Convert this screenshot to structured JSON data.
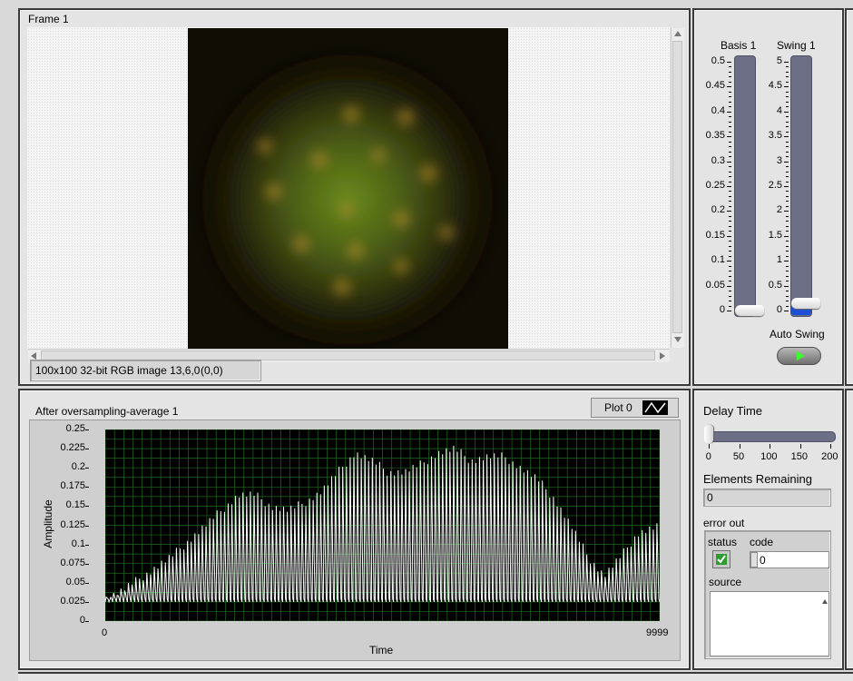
{
  "frame_panel": {
    "title": "Frame 1",
    "image_info": "100x100 32-bit RGB image 13,6,0",
    "cursor_coords": "(0,0)"
  },
  "sliders": {
    "basis": {
      "label": "Basis 1",
      "ticks": [
        "0.5",
        "0.45",
        "0.4",
        "0.35",
        "0.3",
        "0.25",
        "0.2",
        "0.15",
        "0.1",
        "0.05",
        "0"
      ],
      "value": 0
    },
    "swing": {
      "label": "Swing 1",
      "ticks": [
        "5",
        "4.5",
        "4",
        "3.5",
        "3",
        "2.5",
        "2",
        "1.5",
        "1",
        "0.5",
        "0"
      ],
      "value": 0
    },
    "auto_swing_label": "Auto Swing"
  },
  "graph": {
    "title": "After oversampling-average 1",
    "plot_legend": "Plot 0",
    "y_label": "Amplitude",
    "x_label": "Time",
    "x_ticks": [
      "0",
      "9999"
    ],
    "y_ticks": [
      "0.25",
      "0.225",
      "0.2",
      "0.175",
      "0.15",
      "0.125",
      "0.1",
      "0.075",
      "0.05",
      "0.025",
      "0"
    ],
    "colors": {
      "plot_bg": "#000000",
      "grid": "#1f6a1f",
      "trace": "#ffffff"
    }
  },
  "chart_data": {
    "type": "line",
    "title": "After oversampling-average 1",
    "xlabel": "Time",
    "ylabel": "Amplitude",
    "xlim": [
      0,
      9999
    ],
    "ylim": [
      0,
      0.25
    ],
    "grid": true,
    "series": [
      {
        "name": "Plot 0",
        "x": [
          0,
          300,
          600,
          900,
          1200,
          1500,
          1800,
          2100,
          2400,
          2700,
          3000,
          3300,
          3600,
          3900,
          4200,
          4500,
          4800,
          5100,
          5400,
          5700,
          6000,
          6300,
          6600,
          6900,
          7200,
          7500,
          7800,
          8100,
          8400,
          8700,
          9000,
          9300,
          9600,
          9999
        ],
        "y_peak": [
          0.035,
          0.045,
          0.06,
          0.075,
          0.09,
          0.11,
          0.13,
          0.15,
          0.17,
          0.17,
          0.155,
          0.15,
          0.16,
          0.175,
          0.2,
          0.225,
          0.215,
          0.2,
          0.2,
          0.21,
          0.225,
          0.23,
          0.215,
          0.22,
          0.22,
          0.205,
          0.19,
          0.165,
          0.13,
          0.09,
          0.065,
          0.09,
          0.12,
          0.13
        ],
        "y_floor": [
          0.025,
          0.025,
          0.025,
          0.025,
          0.025,
          0.025,
          0.025,
          0.025,
          0.025,
          0.025,
          0.025,
          0.025,
          0.025,
          0.025,
          0.025,
          0.025,
          0.025,
          0.025,
          0.025,
          0.025,
          0.025,
          0.025,
          0.025,
          0.025,
          0.025,
          0.025,
          0.025,
          0.025,
          0.025,
          0.025,
          0.025,
          0.025,
          0.025,
          0.025
        ]
      }
    ]
  },
  "delay": {
    "label": "Delay Time",
    "ticks": [
      "0",
      "50",
      "100",
      "150",
      "200"
    ],
    "value": 0
  },
  "elements": {
    "label": "Elements Remaining",
    "value": "0"
  },
  "error_out": {
    "label": "error out",
    "status_label": "status",
    "code_label": "code",
    "code_value": "0",
    "source_label": "source",
    "source_value": ""
  }
}
